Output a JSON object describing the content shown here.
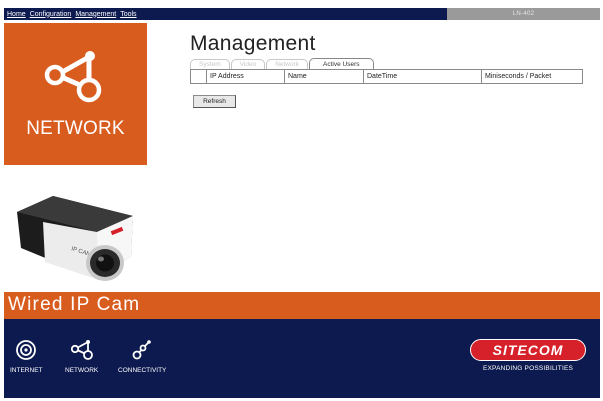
{
  "nav": {
    "links": [
      "Home",
      "Configuration",
      "Management",
      "Tools"
    ],
    "device_model": "LN-402"
  },
  "sidebar": {
    "panel_label": "NETWORK",
    "panel_icon": "network-nodes-icon",
    "camera_image": "ip-camera-image",
    "camera_brand_text": "IP CAM"
  },
  "main": {
    "title": "Management",
    "tabs": [
      {
        "label": "System",
        "active": false
      },
      {
        "label": "Video",
        "active": false
      },
      {
        "label": "Network",
        "active": false
      },
      {
        "label": "Active Users",
        "active": true
      }
    ],
    "table": {
      "columns": [
        "",
        "IP Address",
        "Name",
        "DateTime",
        "Miniseconds / Packet"
      ],
      "rows": []
    },
    "refresh_label": "Refresh"
  },
  "product": {
    "name": "Wired IP Cam"
  },
  "footer": {
    "items": [
      {
        "label": "INTERNET",
        "icon": "globe-target-icon"
      },
      {
        "label": "NETWORK",
        "icon": "network-nodes-icon"
      },
      {
        "label": "CONNECTIVITY",
        "icon": "connectivity-links-icon"
      }
    ],
    "brand": "SITECOM",
    "tagline": "EXPANDING POSSIBILITIES"
  },
  "colors": {
    "navy": "#0d1a4f",
    "orange": "#d95c1f",
    "brand_red": "#d6202a",
    "device_box_gray": "#9a9a9a"
  }
}
